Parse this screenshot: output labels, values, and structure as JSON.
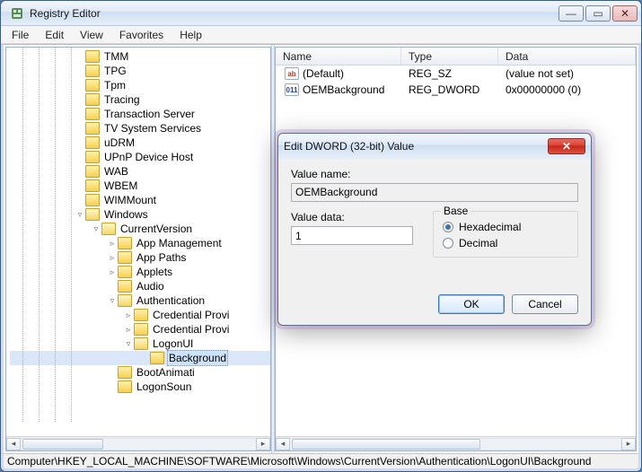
{
  "window": {
    "title": "Registry Editor",
    "buttons": {
      "min": "—",
      "max": "▭",
      "close": "✕"
    }
  },
  "menu": [
    "File",
    "Edit",
    "View",
    "Favorites",
    "Help"
  ],
  "tree": {
    "nodes": [
      {
        "depth": 4,
        "twisty": "",
        "label": "TMM"
      },
      {
        "depth": 4,
        "twisty": "",
        "label": "TPG"
      },
      {
        "depth": 4,
        "twisty": "",
        "label": "Tpm"
      },
      {
        "depth": 4,
        "twisty": "",
        "label": "Tracing"
      },
      {
        "depth": 4,
        "twisty": "",
        "label": "Transaction Server"
      },
      {
        "depth": 4,
        "twisty": "",
        "label": "TV System Services"
      },
      {
        "depth": 4,
        "twisty": "",
        "label": "uDRM"
      },
      {
        "depth": 4,
        "twisty": "",
        "label": "UPnP Device Host"
      },
      {
        "depth": 4,
        "twisty": "",
        "label": "WAB"
      },
      {
        "depth": 4,
        "twisty": "",
        "label": "WBEM"
      },
      {
        "depth": 4,
        "twisty": "",
        "label": "WIMMount"
      },
      {
        "depth": 4,
        "twisty": "▿",
        "label": "Windows",
        "open": true
      },
      {
        "depth": 5,
        "twisty": "▿",
        "label": "CurrentVersion",
        "open": true
      },
      {
        "depth": 6,
        "twisty": "▹",
        "label": "App Management"
      },
      {
        "depth": 6,
        "twisty": "▹",
        "label": "App Paths"
      },
      {
        "depth": 6,
        "twisty": "▹",
        "label": "Applets"
      },
      {
        "depth": 6,
        "twisty": "",
        "label": "Audio"
      },
      {
        "depth": 6,
        "twisty": "▿",
        "label": "Authentication",
        "open": true
      },
      {
        "depth": 7,
        "twisty": "▹",
        "label": "Credential Provi"
      },
      {
        "depth": 7,
        "twisty": "▹",
        "label": "Credential Provi"
      },
      {
        "depth": 7,
        "twisty": "▿",
        "label": "LogonUI",
        "open": true
      },
      {
        "depth": 8,
        "twisty": "",
        "label": "Background",
        "selected": true
      },
      {
        "depth": 6,
        "twisty": "",
        "label": "BootAnimati"
      },
      {
        "depth": 6,
        "twisty": "",
        "label": "LogonSoun"
      }
    ]
  },
  "list": {
    "headers": {
      "name": "Name",
      "type": "Type",
      "data": "Data"
    },
    "rows": [
      {
        "icon": "sz",
        "iconText": "ab",
        "name": "(Default)",
        "type": "REG_SZ",
        "data": "(value not set)"
      },
      {
        "icon": "dw",
        "iconText": "011",
        "name": "OEMBackground",
        "type": "REG_DWORD",
        "data": "0x00000000 (0)"
      }
    ]
  },
  "dialog": {
    "title": "Edit DWORD (32-bit) Value",
    "close_glyph": "✕",
    "value_name_label": "Value name:",
    "value_name": "OEMBackground",
    "value_data_label": "Value data:",
    "value_data": "1",
    "base_legend": "Base",
    "radio_hex": "Hexadecimal",
    "radio_dec": "Decimal",
    "base_selected": "hex",
    "ok": "OK",
    "cancel": "Cancel"
  },
  "statusbar": "Computer\\HKEY_LOCAL_MACHINE\\SOFTWARE\\Microsoft\\Windows\\CurrentVersion\\Authentication\\LogonUI\\Background"
}
